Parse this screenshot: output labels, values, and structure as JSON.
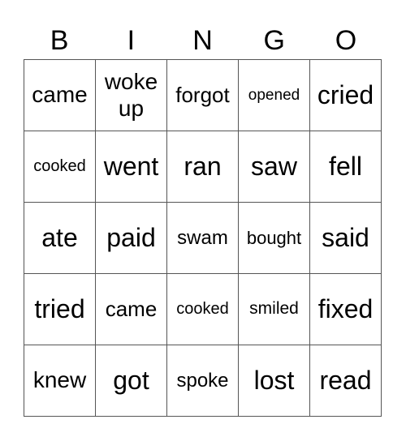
{
  "header": [
    "B",
    "I",
    "N",
    "G",
    "O"
  ],
  "cells": [
    [
      {
        "text": "came",
        "size": 28
      },
      {
        "text": "woke up",
        "size": 28
      },
      {
        "text": "forgot",
        "size": 26
      },
      {
        "text": "opened",
        "size": 19
      },
      {
        "text": "cried",
        "size": 32
      }
    ],
    [
      {
        "text": "cooked",
        "size": 20
      },
      {
        "text": "went",
        "size": 32
      },
      {
        "text": "ran",
        "size": 32
      },
      {
        "text": "saw",
        "size": 32
      },
      {
        "text": "fell",
        "size": 32
      }
    ],
    [
      {
        "text": "ate",
        "size": 32
      },
      {
        "text": "paid",
        "size": 32
      },
      {
        "text": "swam",
        "size": 24
      },
      {
        "text": "bought",
        "size": 22
      },
      {
        "text": "said",
        "size": 32
      }
    ],
    [
      {
        "text": "tried",
        "size": 32
      },
      {
        "text": "came",
        "size": 26
      },
      {
        "text": "cooked",
        "size": 20
      },
      {
        "text": "smiled",
        "size": 21
      },
      {
        "text": "fixed",
        "size": 32
      }
    ],
    [
      {
        "text": "knew",
        "size": 28
      },
      {
        "text": "got",
        "size": 32
      },
      {
        "text": "spoke",
        "size": 24
      },
      {
        "text": "lost",
        "size": 32
      },
      {
        "text": "read",
        "size": 32
      }
    ]
  ]
}
